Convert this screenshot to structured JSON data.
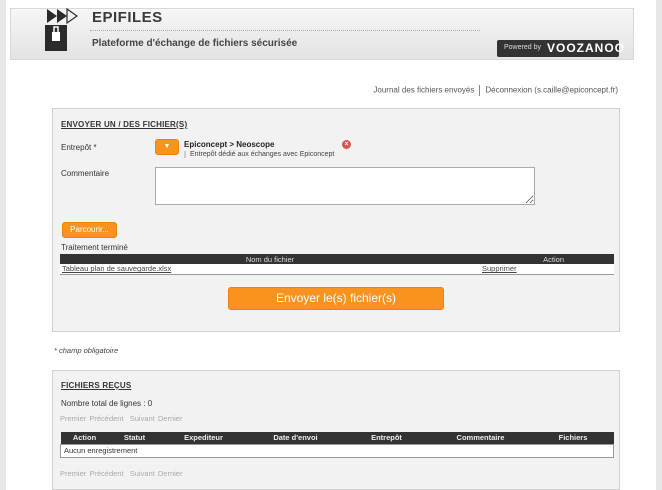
{
  "header": {
    "app_name": "EPIFILES",
    "subtitle": "Plateforme d'échange de fichiers sécurisée",
    "powered_by": "Powered by",
    "brand": "VOOZANOO"
  },
  "top_links": {
    "journal": "Journal des fichiers envoyés",
    "logout": "Déconnexion (s.caille@epiconcept.fr)"
  },
  "send_panel": {
    "title": "Envoyer un / des fichier(s)",
    "entrepot_label": "Entrepôt *",
    "entrepot_button": "▼",
    "store_title": "Epiconcept > Neoscope",
    "store_desc": "Entrepôt dédié aux échanges avec Epiconcept",
    "remove_icon": "×",
    "comment_label": "Commentaire",
    "browse_button": "Parcourir...",
    "status": "Traitement terminé",
    "table": {
      "headers": [
        "Nom du fichier",
        "Action"
      ],
      "rows": [
        {
          "file": "Tableau plan de sauvegarde.xlsx",
          "action": "Supprimer"
        }
      ]
    },
    "send_button": "Envoyer le(s) fichier(s)"
  },
  "mandatory_note": "* champ obligatoire",
  "recv_panel": {
    "title": "Fichiers reçus",
    "total": "Nombre total de lignes : 0",
    "pager": {
      "first": "Premier",
      "prev": "Précédent",
      "next": "Suivant",
      "last": "Dernier"
    },
    "headers": [
      "Action",
      "Statut",
      "Expediteur",
      "Date d'envoi",
      "Entrepôt",
      "Commentaire",
      "Fichiers"
    ],
    "empty": "Aucun enregistrement"
  },
  "colors": {
    "accent": "#f7931e",
    "header_dark": "#333333"
  }
}
